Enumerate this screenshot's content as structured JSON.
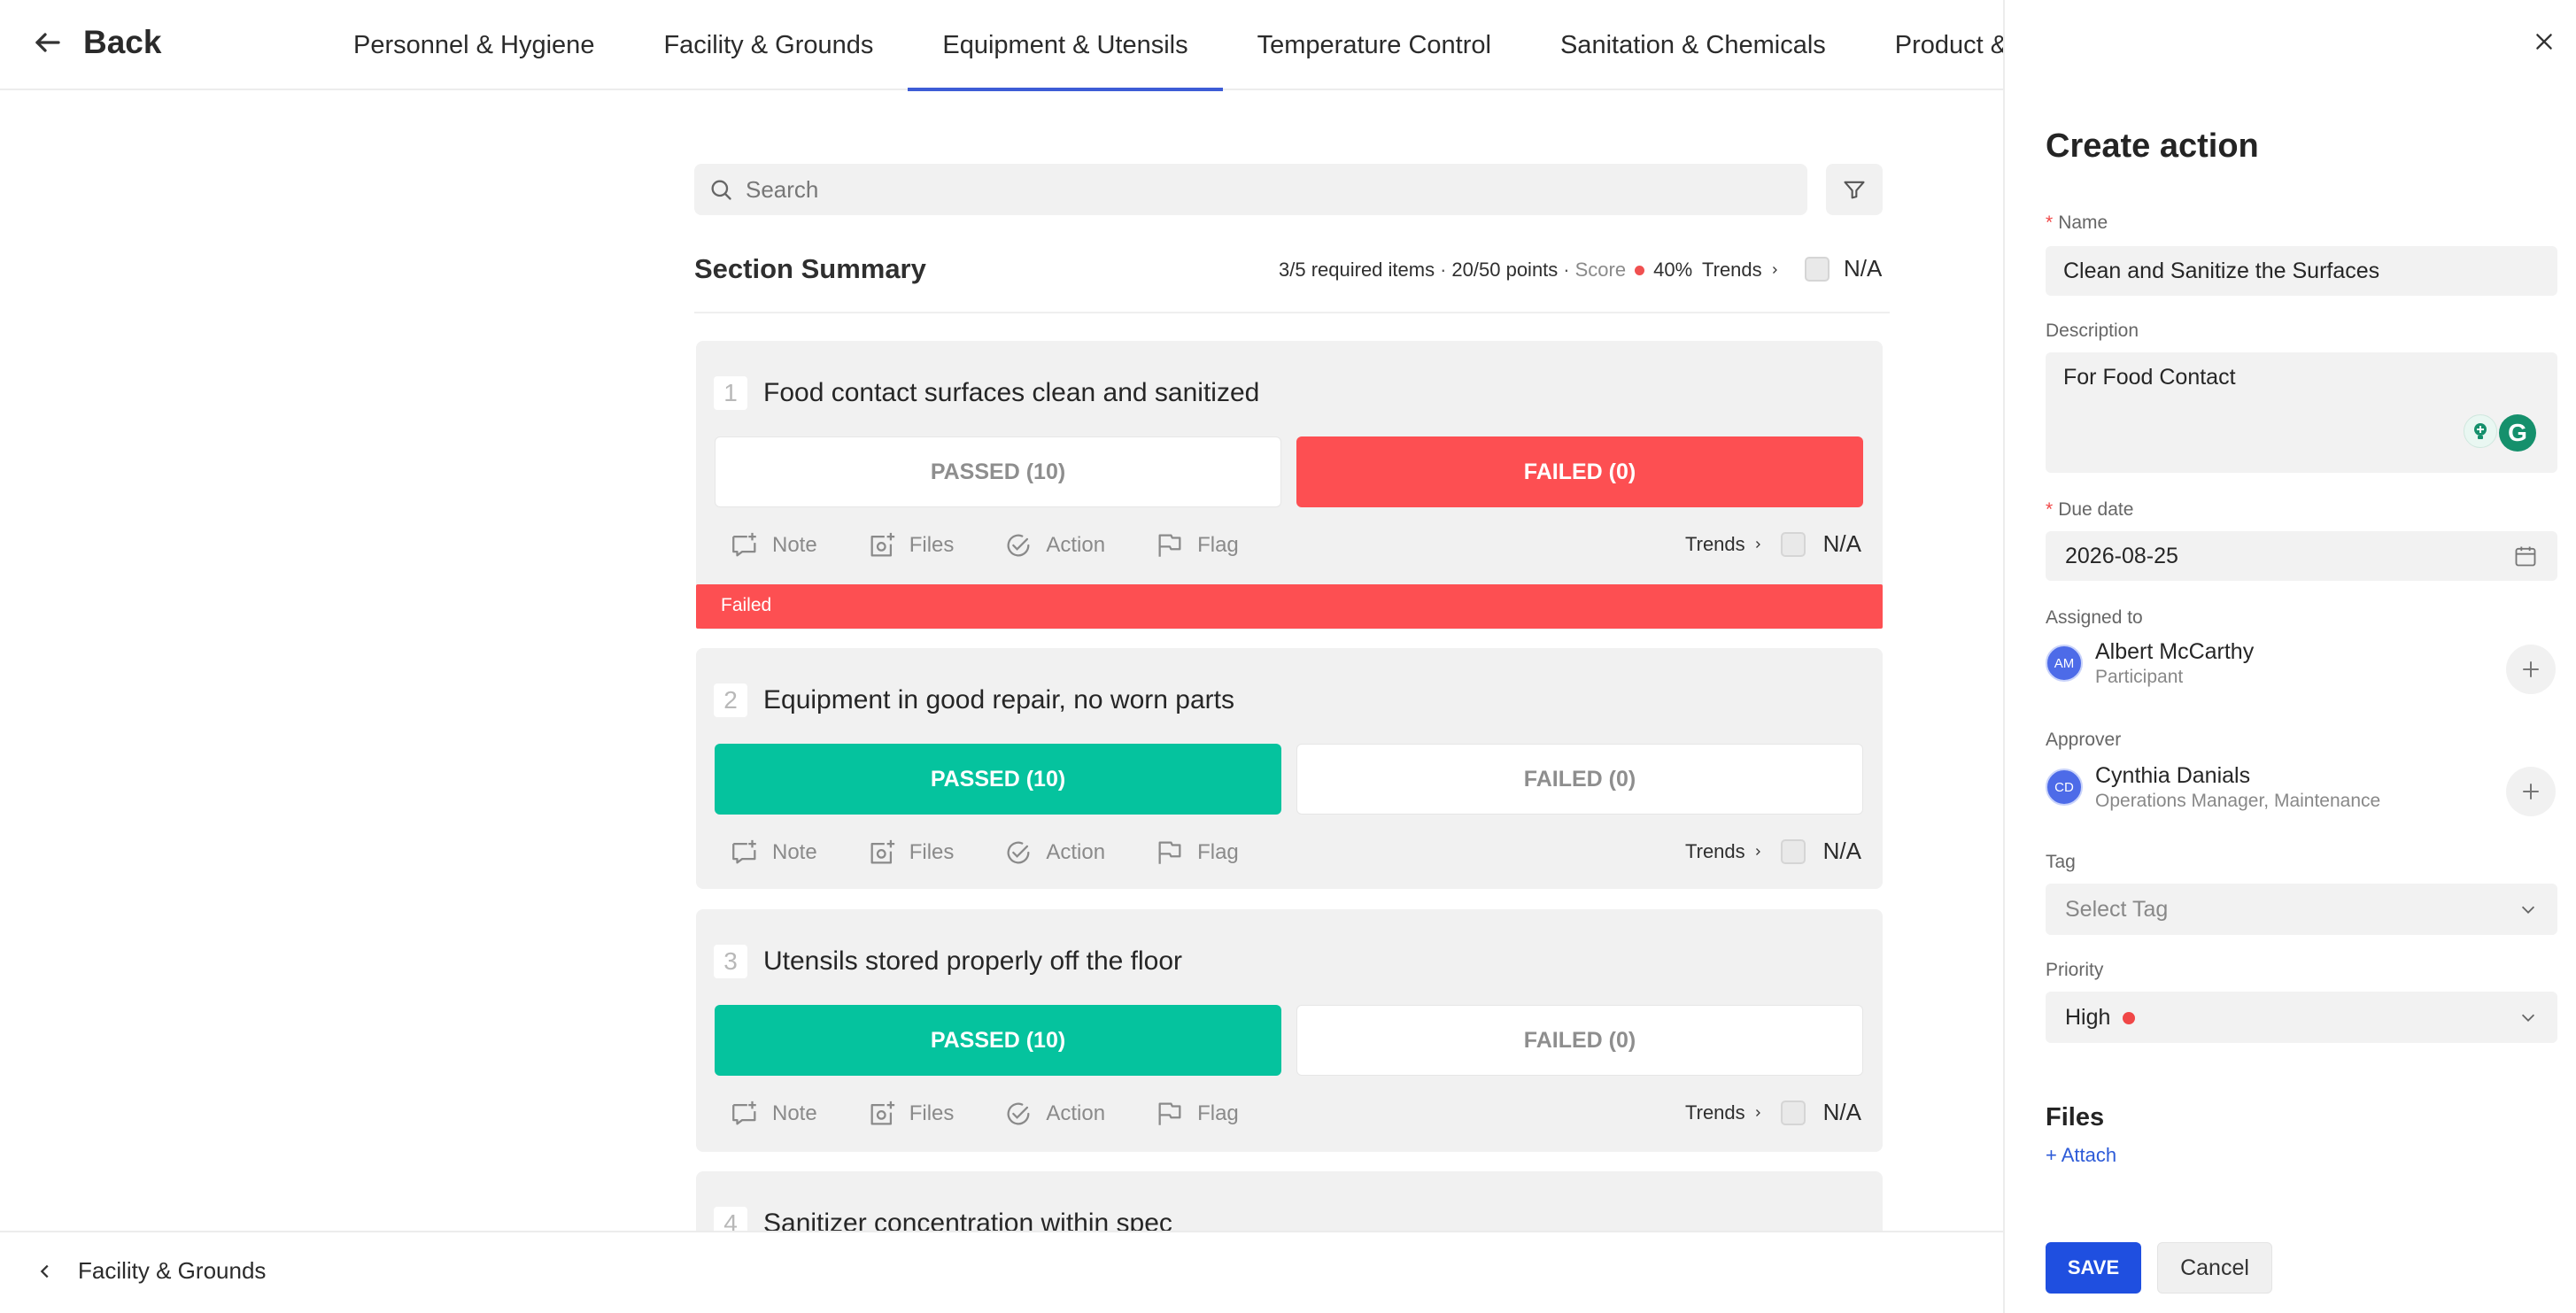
{
  "header": {
    "back_label": "Back",
    "tabs": [
      {
        "label": "Personnel & Hygiene"
      },
      {
        "label": "Facility & Grounds"
      },
      {
        "label": "Equipment & Utensils",
        "active": true
      },
      {
        "label": "Temperature Control"
      },
      {
        "label": "Sanitation & Chemicals"
      },
      {
        "label": "Product & Al"
      }
    ]
  },
  "search": {
    "placeholder": "Search"
  },
  "summary": {
    "title": "Section Summary",
    "required": "3/5 required items",
    "points": "20/50 points",
    "score_label": "Score",
    "score_value": "40%",
    "trends": "Trends",
    "na": "N/A"
  },
  "items": [
    {
      "number": "1",
      "question": "Food contact surfaces clean and sanitized",
      "pass_label": "PASSED (10)",
      "fail_label": "FAILED (0)",
      "status": "failed",
      "note": "Note",
      "files": "Files",
      "action": "Action",
      "flag": "Flag",
      "trends": "Trends",
      "na": "N/A"
    },
    {
      "number": "2",
      "question": "Equipment in good repair, no worn parts",
      "pass_label": "PASSED (10)",
      "fail_label": "FAILED (0)",
      "status": "passed",
      "note": "Note",
      "files": "Files",
      "action": "Action",
      "flag": "Flag",
      "trends": "Trends",
      "na": "N/A"
    },
    {
      "number": "3",
      "question": "Utensils stored properly off the floor",
      "pass_label": "PASSED (10)",
      "fail_label": "FAILED (0)",
      "status": "passed",
      "note": "Note",
      "files": "Files",
      "action": "Action",
      "flag": "Flag",
      "trends": "Trends",
      "na": "N/A"
    },
    {
      "number": "4",
      "question": "Sanitizer concentration within spec"
    }
  ],
  "failed_banner": "Failed",
  "footer": {
    "prev_section": "Facility & Grounds"
  },
  "panel": {
    "title": "Create action",
    "name_label": "Name",
    "name_value": "Clean and Sanitize the Surfaces",
    "description_label": "Description",
    "description_value": "For Food Contact",
    "due_label": "Due date",
    "due_value": "2026-08-25",
    "assigned_label": "Assigned to",
    "assignee": {
      "initials": "AM",
      "name": "Albert McCarthy",
      "role": "Participant"
    },
    "approver_label": "Approver",
    "approver": {
      "initials": "CD",
      "name": "Cynthia Danials",
      "role": "Operations Manager, Maintenance"
    },
    "tag_label": "Tag",
    "tag_placeholder": "Select Tag",
    "priority_label": "Priority",
    "priority_value": "High",
    "files_title": "Files",
    "attach_label": "+ Attach",
    "save_label": "SAVE",
    "cancel_label": "Cancel"
  },
  "colors": {
    "accent": "#3d5cd6",
    "passed": "#05c39e",
    "failed": "#fd4f52",
    "save": "#1f4fe0",
    "priority_high": "#f04747"
  }
}
